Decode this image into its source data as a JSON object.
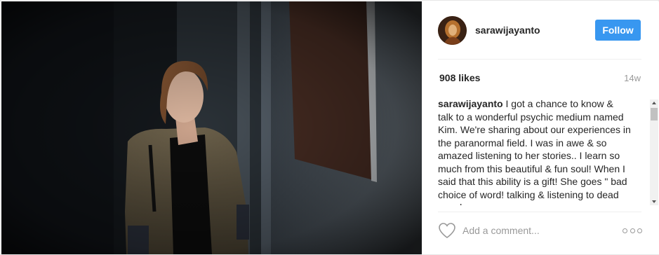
{
  "post": {
    "username": "sarawijayanto",
    "follow_label": "Follow",
    "likes": "908 likes",
    "age": "14w",
    "caption_user": "sarawijayanto",
    "caption_text": "I got a chance to know & talk to a wonderful psychic medium named Kim. We're sharing about our experiences in the paranormal field. I was in awe & so amazed listening to her stories.. I learn so much from this beautiful & fun soul! When I said that this ability is a gift! She goes \" bad choice of word! talking & listening to dead people",
    "comment_placeholder": "Add a comment...",
    "photo_icon": "photo-of-woman-in-dark-hallway",
    "more_icon": "ellipsis-icon",
    "heart_icon": "heart-icon"
  },
  "colors": {
    "follow_button": "#3897f0",
    "text": "#262626",
    "muted": "#999999",
    "divider": "#efefef"
  }
}
